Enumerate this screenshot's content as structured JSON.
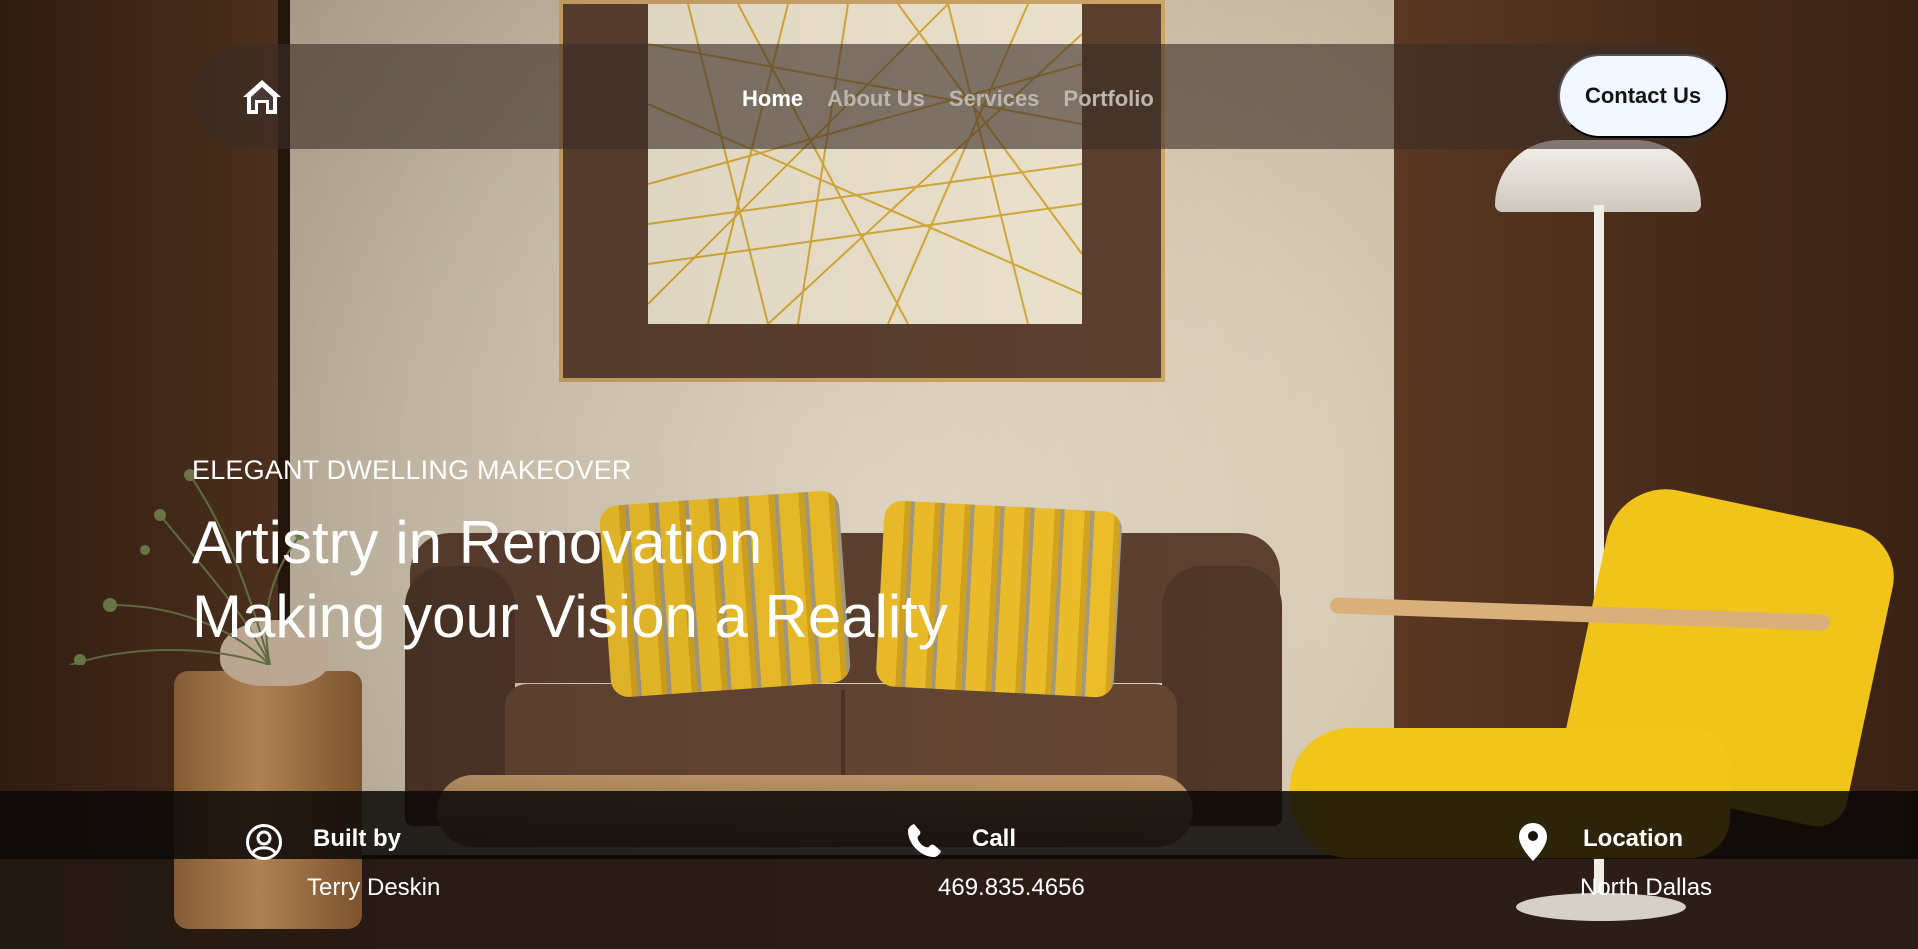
{
  "nav": {
    "home_icon": "home-icon",
    "links": [
      {
        "label": "Home",
        "active": true
      },
      {
        "label": "About Us",
        "active": false
      },
      {
        "label": "Services",
        "active": false
      },
      {
        "label": "Portfolio",
        "active": false
      }
    ],
    "contact_label": "Contact Us"
  },
  "hero": {
    "eyebrow": "ELEGANT DWELLING MAKEOVER",
    "headline_line1": "Artistry in Renovation",
    "headline_line2": "Making your Vision a Reality"
  },
  "info": {
    "built_by": {
      "icon": "user-circle-icon",
      "title": "Built by",
      "value": "Terry Deskin"
    },
    "call": {
      "icon": "phone-icon",
      "title": "Call",
      "value": "469.835.4656"
    },
    "location": {
      "icon": "map-pin-icon",
      "title": "Location",
      "value": "North Dallas"
    }
  },
  "colors": {
    "nav_bg": "#3c2d26",
    "contact_bg": "#f1f6ff",
    "info_bar_bg": "#0a0807",
    "accent_yellow": "#f1c419"
  }
}
